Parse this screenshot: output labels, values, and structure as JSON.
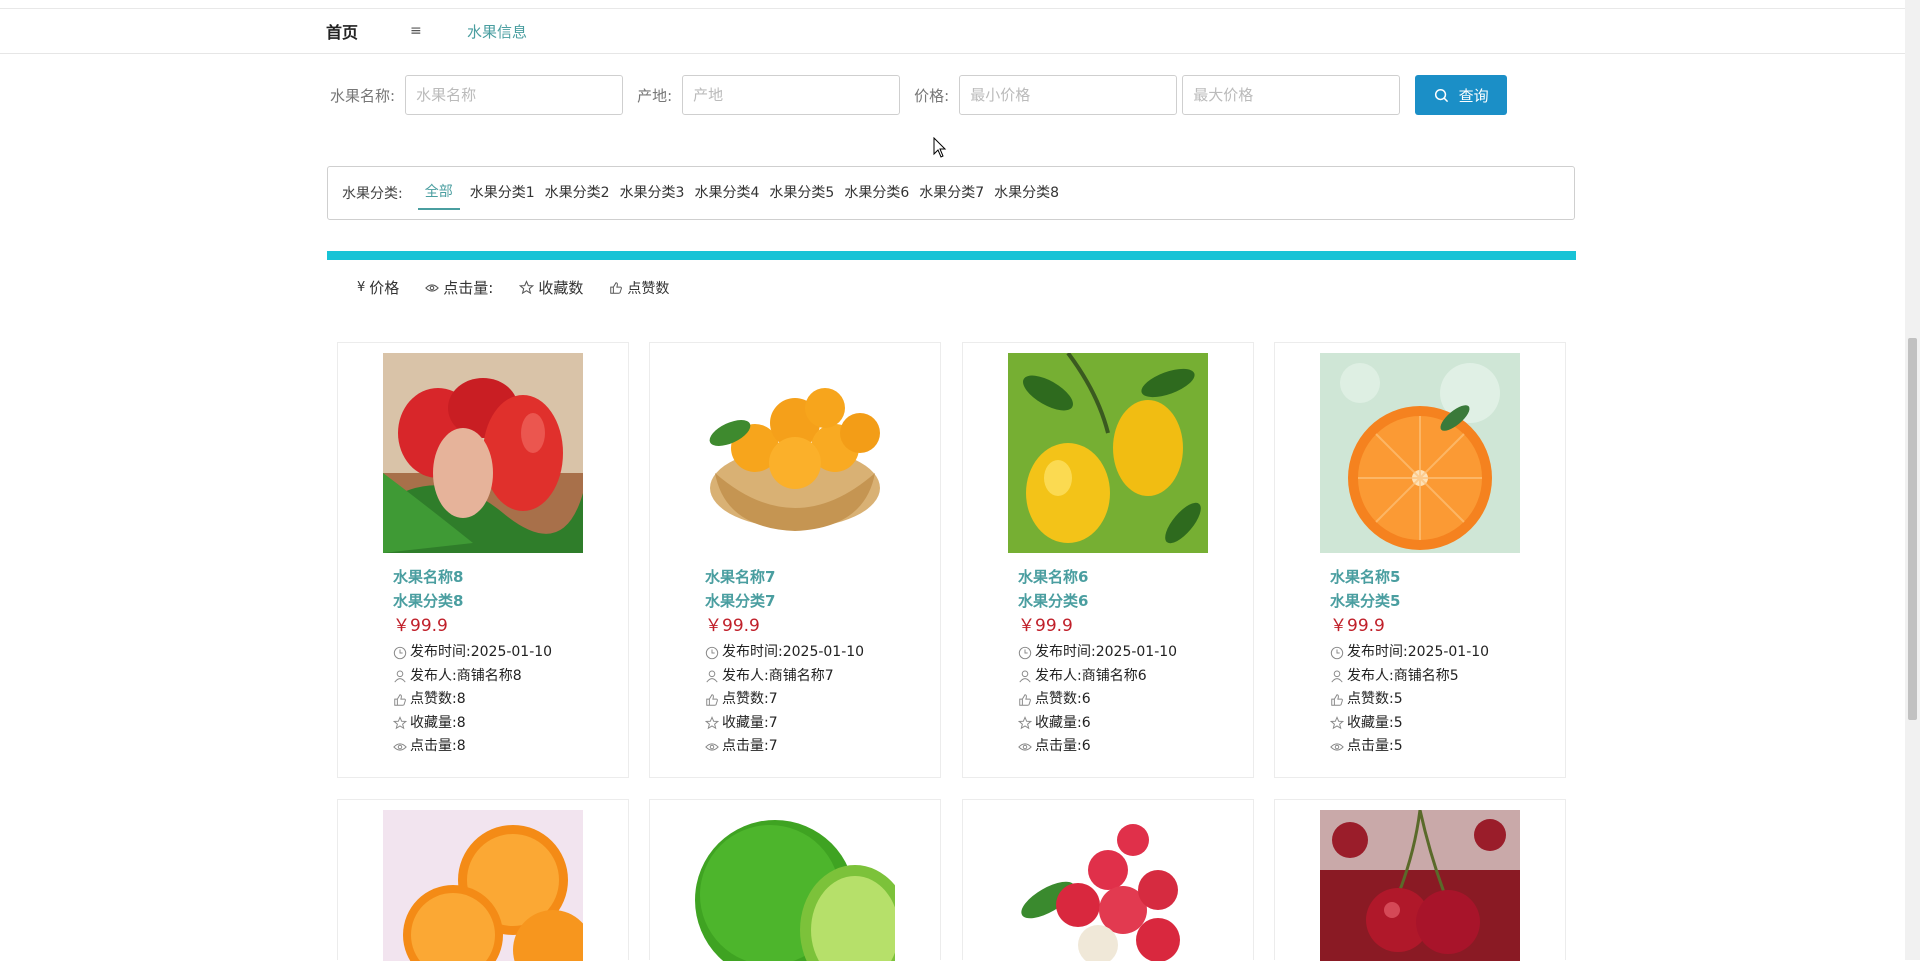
{
  "breadcrumb": {
    "home": "首页",
    "separator": "≡",
    "current": "水果信息"
  },
  "search": {
    "name_label": "水果名称:",
    "name_placeholder": "水果名称",
    "origin_label": "产地:",
    "origin_placeholder": "产地",
    "price_label": "价格:",
    "min_price_placeholder": "最小价格",
    "max_price_placeholder": "最大价格",
    "query_button": "查询"
  },
  "categories": {
    "label": "水果分类:",
    "items": [
      "全部",
      "水果分类1",
      "水果分类2",
      "水果分类3",
      "水果分类4",
      "水果分类5",
      "水果分类6",
      "水果分类7",
      "水果分类8"
    ],
    "active": "全部"
  },
  "sort": {
    "price": "价格",
    "clicks": "点击量:",
    "favorites": "收藏数",
    "likes": "点赞数"
  },
  "meta_labels": {
    "time": "发布时间:",
    "publisher": "发布人:",
    "likes": "点赞数:",
    "favorites": "收藏量:",
    "clicks": "点击量:"
  },
  "products": [
    {
      "name": "水果名称8",
      "category": "水果分类8",
      "price": "￥99.9",
      "time": "2025-01-10",
      "publisher": "商铺名称8",
      "likes": "8",
      "favorites": "8",
      "clicks": "8"
    },
    {
      "name": "水果名称7",
      "category": "水果分类7",
      "price": "￥99.9",
      "time": "2025-01-10",
      "publisher": "商铺名称7",
      "likes": "7",
      "favorites": "7",
      "clicks": "7"
    },
    {
      "name": "水果名称6",
      "category": "水果分类6",
      "price": "￥99.9",
      "time": "2025-01-10",
      "publisher": "商铺名称6",
      "likes": "6",
      "favorites": "6",
      "clicks": "6"
    },
    {
      "name": "水果名称5",
      "category": "水果分类5",
      "price": "￥99.9",
      "time": "2025-01-10",
      "publisher": "商铺名称5",
      "likes": "5",
      "favorites": "5",
      "clicks": "5"
    }
  ],
  "colors": {
    "accent": "#4a9ea0",
    "price": "#c0202a",
    "button": "#1b8fc7",
    "bar": "#18c3d6"
  }
}
